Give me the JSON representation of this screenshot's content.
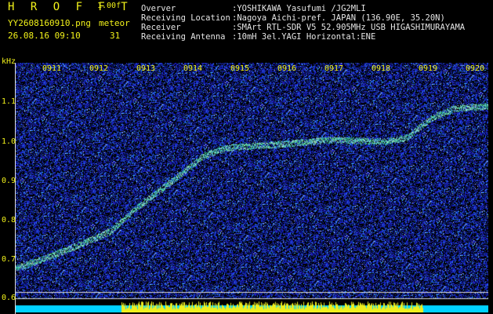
{
  "header": {
    "title": "H R O F F T",
    "version": "1.00f",
    "filename": "YY2608160910.png",
    "meteor_label": "meteor",
    "datetime": "26.08.16 09:10",
    "meteor_count": "31"
  },
  "info": [
    {
      "label": "Overver",
      "value": ":YOSHIKAWA Yasufumi /JG2MLI"
    },
    {
      "label": "Receiving Location",
      "value": ":Nagoya Aichi-pref. JAPAN (136.90E, 35.20N)"
    },
    {
      "label": "Receiver",
      "value": ":SMArt RTL-SDR V5 52.905MHz USB HIGASHIMURAYAMA"
    },
    {
      "label": "Receiving Antenna",
      "value": ":10mH 3el.YAGI Horizontal:ENE"
    }
  ],
  "axis": {
    "unit": "kHz",
    "frequency_ticks": [
      "1.1",
      "1.0",
      "0.9",
      "0.8",
      "0.7",
      "0.6"
    ],
    "time_ticks": [
      "0911",
      "0912",
      "0913",
      "0914",
      "0915",
      "0916",
      "0917",
      "0918",
      "0919",
      "0920"
    ]
  },
  "colors": {
    "label_yellow": "#f2f21a",
    "header_text": "#e6e6e6",
    "background_noise": "#1a1ad2",
    "trace": "#46e6aa",
    "strip_cyan": "#00d2ff",
    "strip_yellow": "#f0f01e"
  }
}
